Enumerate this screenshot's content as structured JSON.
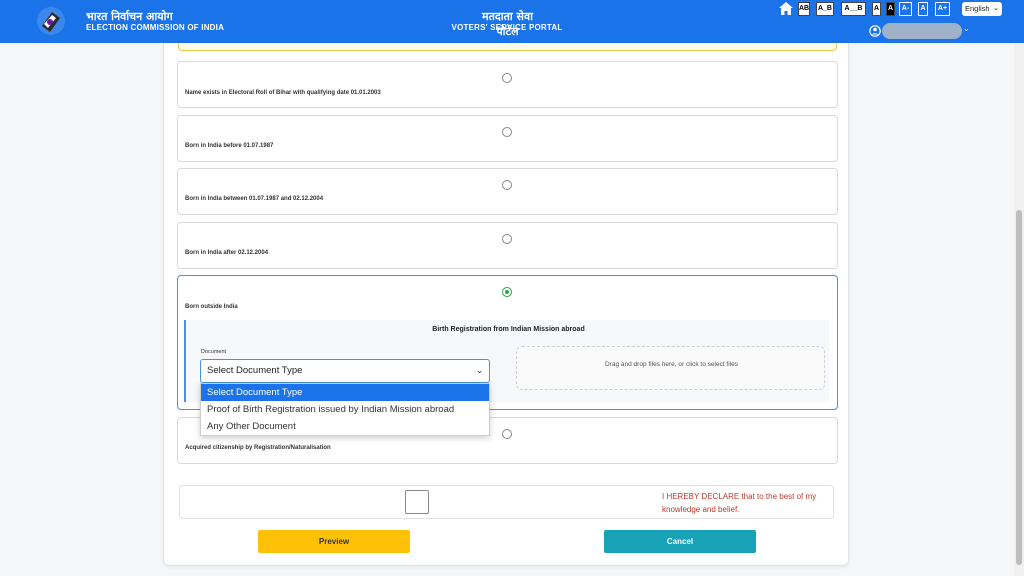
{
  "header": {
    "eci_hindi": "भारत निर्वाचन आयोग",
    "eci_english": "ELECTION COMMISSION OF INDIA",
    "portal_hindi": "मतदाता सेवा पोर्टल",
    "portal_english": "VOTERS' SERVICE PORTAL",
    "accent_color": "#1a73e8"
  },
  "accessibility": {
    "buttons": [
      "AB",
      "A_B",
      "A__B",
      "A",
      "A",
      "A-",
      "A",
      "A+"
    ],
    "language": "English"
  },
  "options": [
    {
      "label": "Name exists in Electoral Roll of Bihar with qualifying date 01.01.2003",
      "selected": false
    },
    {
      "label": "Born in India before 01.07.1987",
      "selected": false
    },
    {
      "label": "Born in India between 01.07.1987 and 02.12.2004",
      "selected": false
    },
    {
      "label": "Born in India after 02.12.2004",
      "selected": false
    },
    {
      "label": "Born outside India",
      "selected": true
    },
    {
      "label": "Acquired citizenship by Registration/Naturalisation",
      "selected": false
    }
  ],
  "sub_panel": {
    "title": "Birth Registration from Indian Mission abroad",
    "document_label": "Document",
    "select_value": "Select Document Type",
    "dropzone_text": "Drag and drop files here, or click to select files"
  },
  "dropdown": {
    "options": [
      "Select Document Type",
      "Proof of Birth Registration issued by Indian Mission abroad",
      "Any Other Document"
    ]
  },
  "declaration": {
    "text": "I HEREBY DECLARE that to the best of my knowledge and belief."
  },
  "actions": {
    "preview": "Preview",
    "cancel": "Cancel"
  }
}
